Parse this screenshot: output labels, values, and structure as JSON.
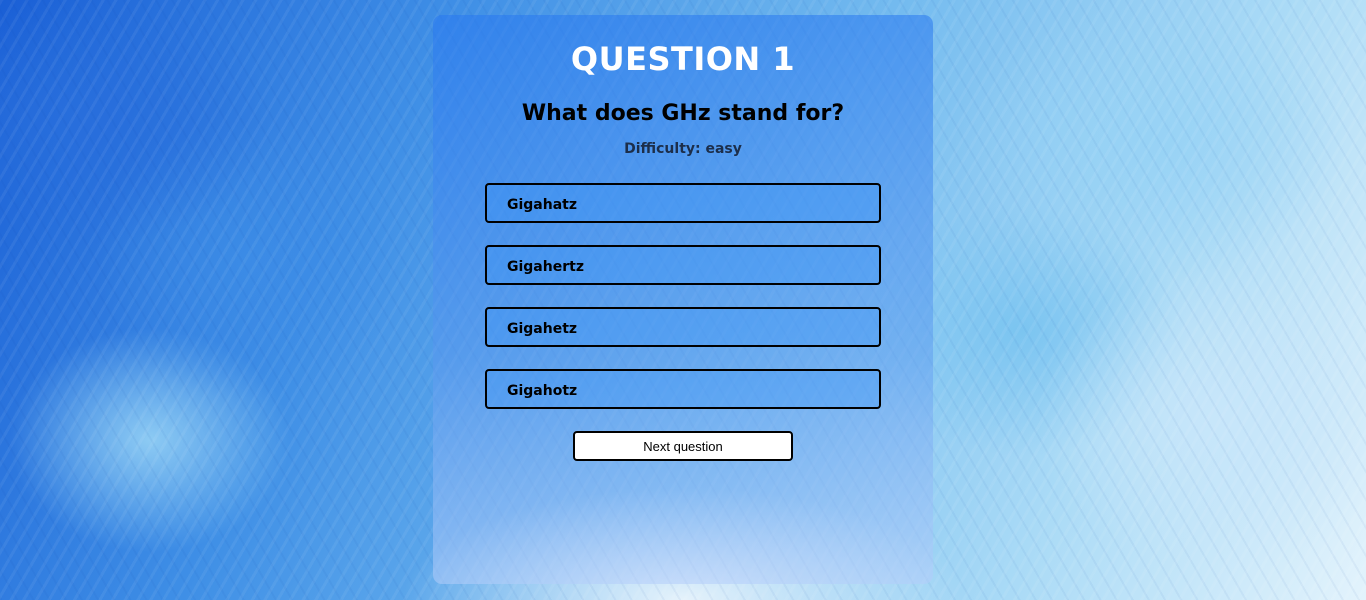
{
  "quiz": {
    "question_number": "QUESTION 1",
    "question_text": "What does GHz stand for?",
    "difficulty_label": "Difficulty: ",
    "difficulty_value": "easy",
    "answers": [
      {
        "label": "Gigahatz"
      },
      {
        "label": "Gigahertz"
      },
      {
        "label": "Gigahetz"
      },
      {
        "label": "Gigahotz"
      }
    ],
    "next_label": "Next question"
  },
  "colors": {
    "card_tint": "#2878f0",
    "text_title": "#ffffff",
    "text_dark": "#000000",
    "button_bg": "#ffffff"
  }
}
